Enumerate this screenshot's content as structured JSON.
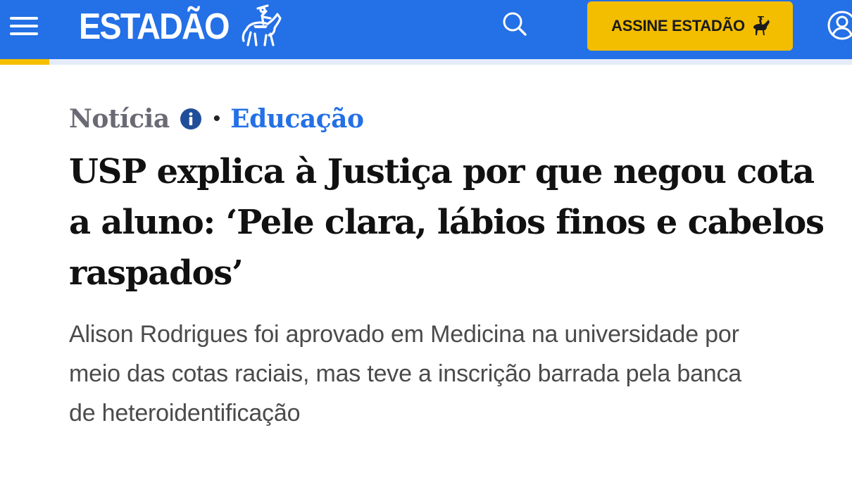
{
  "header": {
    "logo_text": "ESTADÃO",
    "subscribe_label": "ASSINE ESTADÃO",
    "background_color": "#2470e6",
    "accent_color": "#f3bd00",
    "icons": [
      "menu-icon",
      "horse-rider-logo-icon",
      "search-icon",
      "horse-rider-icon",
      "user-icon"
    ]
  },
  "reading_progress": 0.058,
  "article": {
    "type_label": "Notícia",
    "category": "Educação",
    "bullet": "•",
    "headline": "USP explica à Justiça por que negou cota a aluno: ‘Pele clara, lábios finos e cabelos raspados’",
    "subtitle": "Alison Rodrigues foi aprovado em Medicina na universidade por meio das cotas raciais, mas teve a inscrição barrada pela banca de heteroidentificação"
  }
}
